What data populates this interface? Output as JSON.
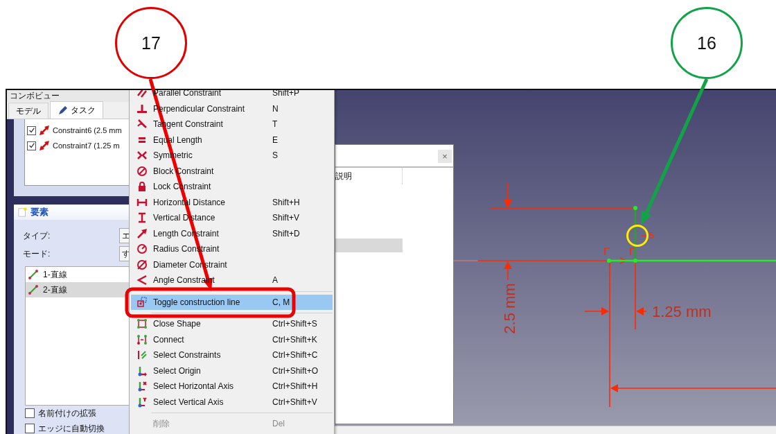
{
  "callouts": [
    {
      "label": "17",
      "color": "#e00000"
    },
    {
      "label": "16",
      "color": "#12a348"
    }
  ],
  "combo_view": {
    "title": "コンボビュー",
    "tabs": [
      {
        "label": "モデル",
        "selected": false
      },
      {
        "label": "タスク",
        "selected": true
      }
    ],
    "constraints": [
      {
        "label": "Constraint6 (2.5 mm",
        "checked": true
      },
      {
        "label": "Constraint7 (1.25 m",
        "checked": true
      }
    ],
    "elements_panel": {
      "title": "要素",
      "type_label": "タイプ:",
      "type_value": "エ",
      "mode_label": "モード:",
      "mode_value": "す",
      "items": [
        {
          "label": "1-直線",
          "selected": false
        },
        {
          "label": "2-直線",
          "selected": true
        }
      ],
      "options": [
        {
          "label": "名前付けの拡張",
          "checked": false
        },
        {
          "label": "エッジに自動切換",
          "checked": false
        }
      ]
    }
  },
  "context_menu": {
    "groups": [
      [
        {
          "label": "Parallel Constraint",
          "shortcut": "Shift+P",
          "selected": false,
          "disabled": false
        },
        {
          "label": "Perpendicular Constraint",
          "shortcut": "N",
          "selected": false,
          "disabled": false
        },
        {
          "label": "Tangent Constraint",
          "shortcut": "T",
          "selected": false,
          "disabled": false
        },
        {
          "label": "Equal Length",
          "shortcut": "E",
          "selected": false,
          "disabled": false
        },
        {
          "label": "Symmetric",
          "shortcut": "S",
          "selected": false,
          "disabled": false
        },
        {
          "label": "Block Constraint",
          "selected": false,
          "disabled": false
        },
        {
          "label": "Lock Constraint",
          "selected": false,
          "disabled": false
        },
        {
          "label": "Horizontal Distance",
          "shortcut": "Shift+H",
          "selected": false,
          "disabled": false
        },
        {
          "label": "Vertical Distance",
          "shortcut": "Shift+V",
          "selected": false,
          "disabled": false
        },
        {
          "label": "Length Constraint",
          "shortcut": "Shift+D",
          "selected": false,
          "disabled": false
        },
        {
          "label": "Radius Constraint",
          "selected": false,
          "disabled": false
        },
        {
          "label": "Diameter Constraint",
          "selected": false,
          "disabled": false
        },
        {
          "label": "Angle Constraint",
          "shortcut": "A",
          "selected": false,
          "disabled": false
        }
      ],
      [
        {
          "label": "Toggle construction line",
          "shortcut": "C, M",
          "selected": true,
          "disabled": false
        }
      ],
      [
        {
          "label": "Close Shape",
          "shortcut": "Ctrl+Shift+S",
          "selected": false,
          "disabled": false
        },
        {
          "label": "Connect",
          "shortcut": "Ctrl+Shift+K",
          "selected": false,
          "disabled": false
        },
        {
          "label": "Select Constraints",
          "shortcut": "Ctrl+Shift+C",
          "selected": false,
          "disabled": false
        },
        {
          "label": "Select Origin",
          "shortcut": "Ctrl+Shift+O",
          "selected": false,
          "disabled": false
        },
        {
          "label": "Select Horizontal Axis",
          "shortcut": "Ctrl+Shift+H",
          "selected": false,
          "disabled": false
        },
        {
          "label": "Select Vertical Axis",
          "shortcut": "Ctrl+Shift+V",
          "selected": false,
          "disabled": false
        }
      ],
      [
        {
          "label": "削除",
          "shortcut": "Del",
          "selected": false,
          "disabled": true
        }
      ]
    ]
  },
  "dialog": {
    "close_label": "×",
    "column_header": "説明"
  },
  "view": {
    "vertical_dimension": "2.5 mm",
    "horizontal_dimension": "1.25 mm",
    "constraint_label": "5"
  }
}
